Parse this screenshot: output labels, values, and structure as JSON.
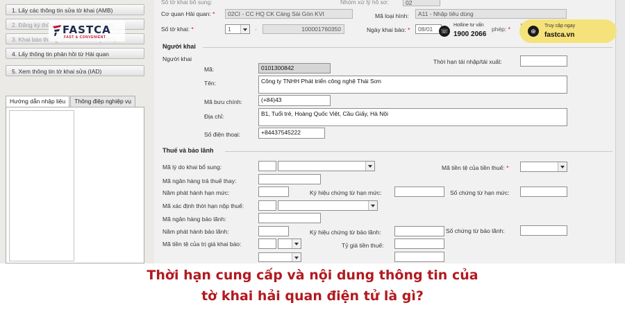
{
  "sidebar": {
    "buttons": [
      {
        "label": "1. Lấy các thông tin sửa tờ khai (AMB)",
        "disabled": false
      },
      {
        "label": "2. Đăng ký thông tin sửa tờ khai (AMA)",
        "disabled": true
      },
      {
        "label": "3. Khai báo thông tin sửa tờ khai (AMC)",
        "disabled": true
      },
      {
        "label": "4. Lấy thông tin phản hồi từ Hải quan",
        "disabled": false
      },
      {
        "label": "5. Xem thông tin tờ khai sửa (IAD)",
        "disabled": false
      }
    ],
    "tabs": [
      "Hướng dẫn nhập liệu",
      "Thông điệp nghiệp vụ"
    ]
  },
  "header": {
    "so_to_khai_bo_sung_label": "Số tờ khai bổ sung:",
    "nhom_xu_ly_label": "Nhóm xử lý hồ sơ:",
    "nhom_xu_ly_value": "02",
    "co_quan_hq_label": "Cơ quan Hải quan:",
    "co_quan_hq_value": "02CI  - CC HQ CK Cảng Sài Gòn KVI",
    "ma_loai_hinh_label": "Mã loại hình:",
    "ma_loai_hinh_value": "A11 - Nhập tiêu dùng",
    "so_to_khai_label": "Số tờ khai:",
    "so_to_khai_prefix": "1",
    "so_to_khai_value": "100001760350",
    "ngay_khai_bao_label": "Ngày khai báo:",
    "ngay_khai_bao_value": "08/01",
    "giay_phep_label": "phép:"
  },
  "nguoi_khai": {
    "group": "Người khai",
    "sub_label": "Người khai",
    "ma_label": "Mã:",
    "ma_value": "0101300842",
    "thoi_han_label": "Thời hạn tái nhập/tái xuất:",
    "ten_label": "Tên:",
    "ten_value": "Công ty TNHH Phát triển công nghệ Thái Sơn",
    "buu_chinh_label": "Mã bưu chính:",
    "buu_chinh_value": "(+84)43",
    "dia_chi_label": "Địa chỉ:",
    "dia_chi_value": "B1, Tuổi trẻ, Hoàng Quốc Việt, Cầu Giấy, Hà Nội",
    "sdt_label": "Số điện thoại:",
    "sdt_value": "+84437545222"
  },
  "thue": {
    "group": "Thuế và bảo lãnh",
    "ly_do_label": "Mã lý do khai bổ sung:",
    "tien_te_thue_label": "Mã tiền tệ của tiền thuế:",
    "ngan_hang_tra_label": "Mã ngân hàng trả thuế thay:",
    "nam_phat_hanh_han_muc_label": "Năm phát hành hạn mức:",
    "ky_hieu_han_muc_label": "Ký hiệu chứng từ hạn mức:",
    "so_chung_tu_han_muc_label": "Số chứng từ hạn mức:",
    "xac_dinh_thoi_han_label": "Mã xác định thời hạn nộp thuế:",
    "ngan_hang_bao_lanh_label": "Mã ngân hàng bảo lãnh:",
    "nam_phat_hanh_bao_lanh_label": "Năm phát hành bảo lãnh:",
    "ky_hieu_bao_lanh_label": "Ký hiệu chứng từ bảo lãnh:",
    "so_chung_tu_bao_lanh_label": "Số chứng từ bảo lãnh:",
    "tien_te_tri_gia_label": "Mã tiền tệ của trị giá khai báo:",
    "ty_gia_label": "Tỷ giá tiền thuế:"
  },
  "overlay": {
    "brand": "FASTCA",
    "tagline": "FAST & CONVENIENT",
    "hotline_label": "Hotline tư vấn",
    "hotline_number": "1900 2066",
    "web_label": "Truy cập ngay",
    "web_url": "fastca.vn"
  },
  "banner": {
    "line1": "Thời hạn cung cấp và nội dung thông tin của",
    "line2": "tờ khai hải quan điện tử là gì?"
  },
  "colors": {
    "banner_text": "#b3191f",
    "web_pill": "#f6e27a"
  }
}
